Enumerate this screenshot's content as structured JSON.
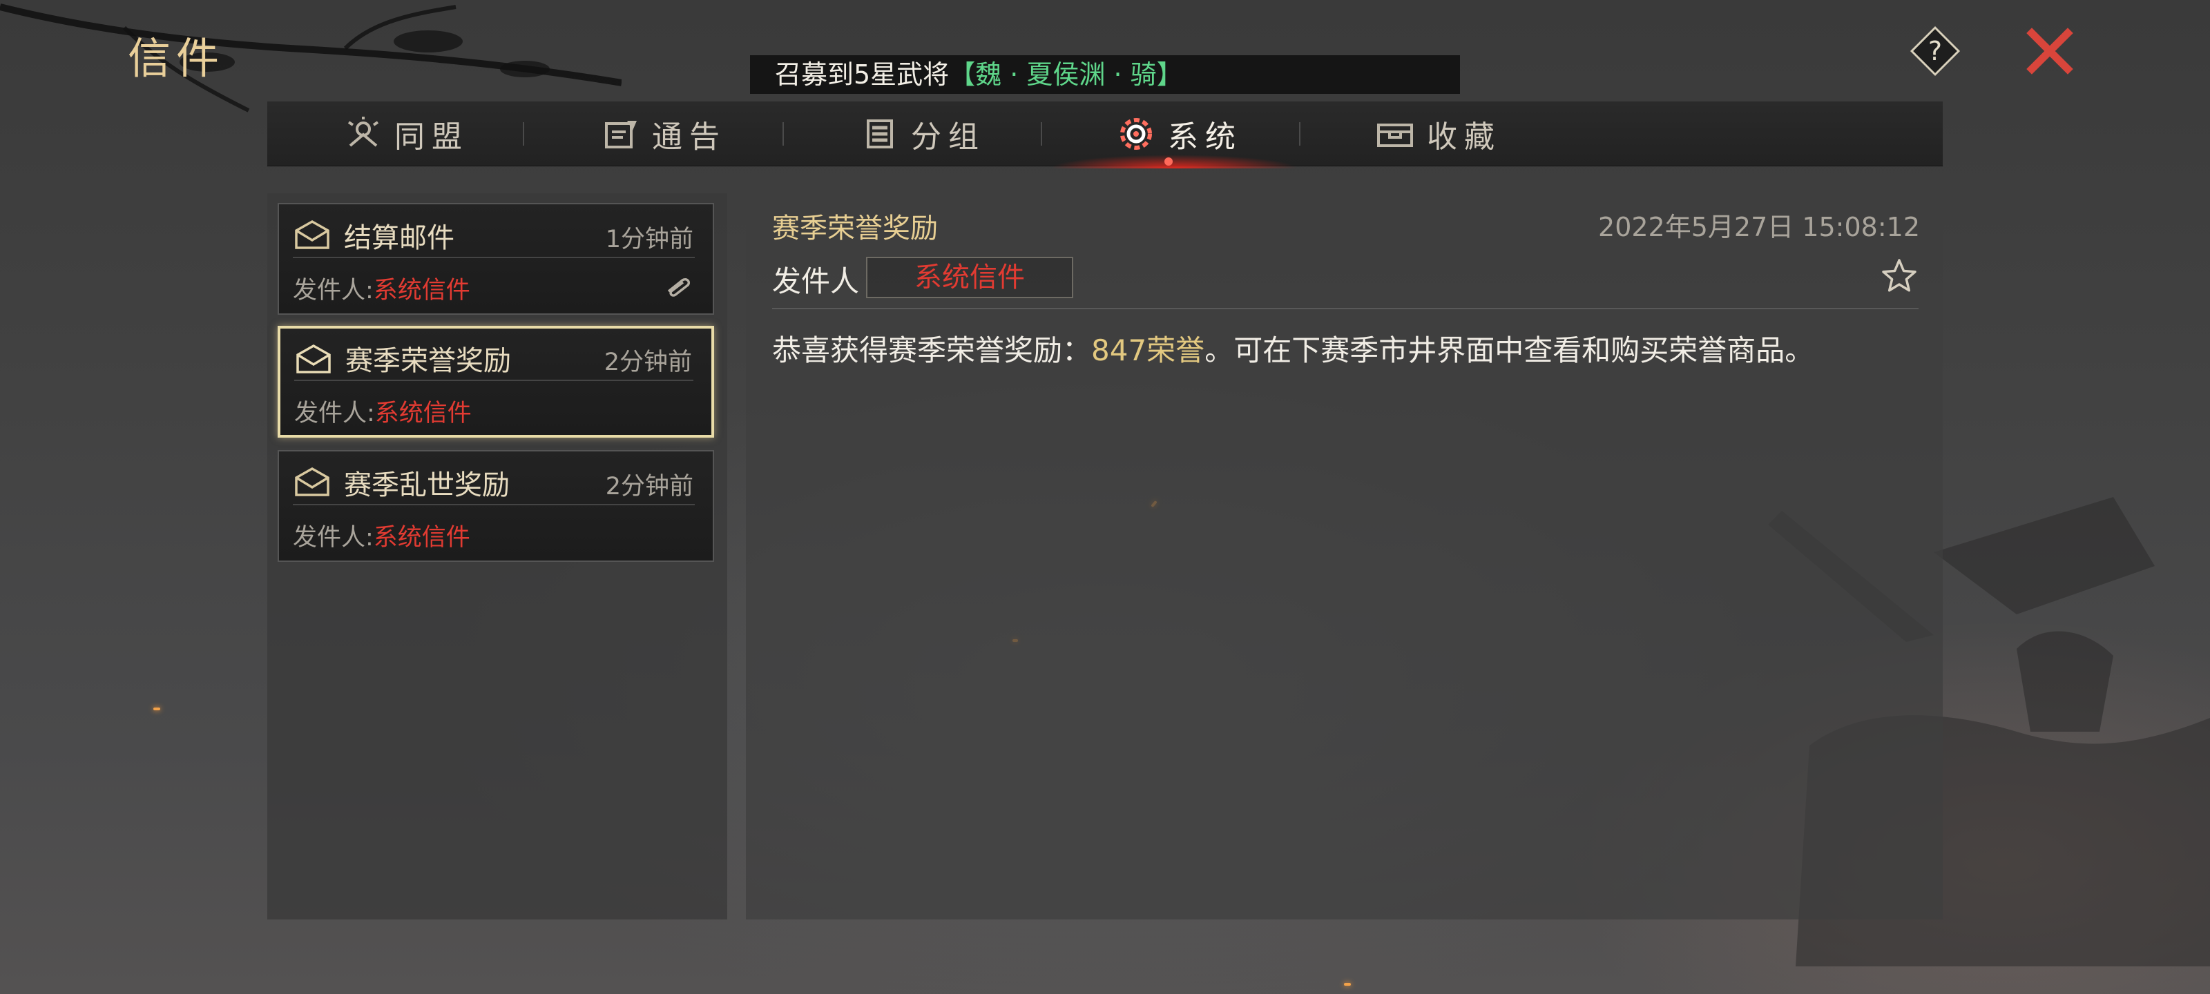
{
  "header": {
    "title": "信件",
    "ticker_text": "召募到5星武将",
    "ticker_highlight": "【魏 · 夏侯渊 · 骑】",
    "help_icon": "question-diamond-icon",
    "close_icon": "close-x-icon"
  },
  "tabs": [
    {
      "label": "同盟",
      "icon": "alliance-icon",
      "active": false
    },
    {
      "label": "通告",
      "icon": "notice-icon",
      "active": false
    },
    {
      "label": "分组",
      "icon": "group-icon",
      "active": false
    },
    {
      "label": "系统",
      "icon": "system-gear-icon",
      "active": true
    },
    {
      "label": "收藏",
      "icon": "favorites-chest-icon",
      "active": false
    }
  ],
  "mail_list": [
    {
      "title": "结算邮件",
      "time": "1分钟前",
      "sender_label": "发件人:",
      "sender": "系统信件",
      "has_attachment": true,
      "selected": false
    },
    {
      "title": "赛季荣誉奖励",
      "time": "2分钟前",
      "sender_label": "发件人:",
      "sender": "系统信件",
      "has_attachment": false,
      "selected": true
    },
    {
      "title": "赛季乱世奖励",
      "time": "2分钟前",
      "sender_label": "发件人:",
      "sender": "系统信件",
      "has_attachment": false,
      "selected": false
    }
  ],
  "detail": {
    "subject": "赛季荣誉奖励",
    "datetime": "2022年5月27日 15:08:12",
    "sender_label": "发件人",
    "sender": "系统信件",
    "body_prefix": "恭喜获得赛季荣誉奖励：",
    "body_highlight": "847荣誉",
    "body_suffix": "。可在下赛季市井界面中查看和购买荣誉商品。"
  },
  "colors": {
    "accent_gold": "#e8cf93",
    "sender_red": "#e23b32",
    "ticker_green": "#5fd68a",
    "close_red": "#d9453b"
  }
}
